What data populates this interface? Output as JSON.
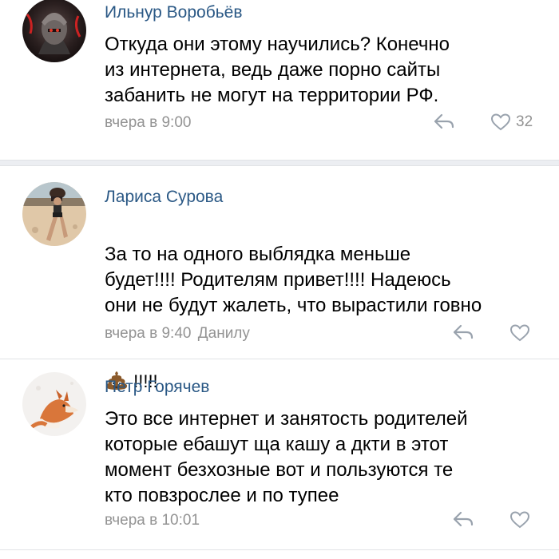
{
  "comments": [
    {
      "author": "Ильнур Воробьёв",
      "text": "Откуда они этому научились? Конечно\nиз интернета, ведь даже порно сайты\nзабанить не могут на территории РФ.",
      "time": "вчера в 9:00",
      "reply_to": "",
      "likes": "32"
    },
    {
      "author": "Лариса Сурова",
      "text": "За то на одного выблядка меньше\nбудет!!!! Родителям привет!!!! Надеюсь\nони не будут жалеть, что вырастили говно",
      "text_tail_emoji": "pile-of-poo",
      "text_tail": " !!!!!",
      "time": "вчера в 9:40",
      "reply_to": "Данилу",
      "likes": ""
    },
    {
      "author": "Петр Горячев",
      "text": "Это все интернет и занятость родителей\nкоторые ебашут ща кашу а дкти в этот\nмомент безхозные вот и пользуются те\nкто повзрослее и по тупее",
      "time": "вчера в 10:01",
      "reply_to": "",
      "likes": ""
    }
  ],
  "colors": {
    "author": "#2a5885",
    "meta": "#939393",
    "separator": "#eceef2"
  }
}
